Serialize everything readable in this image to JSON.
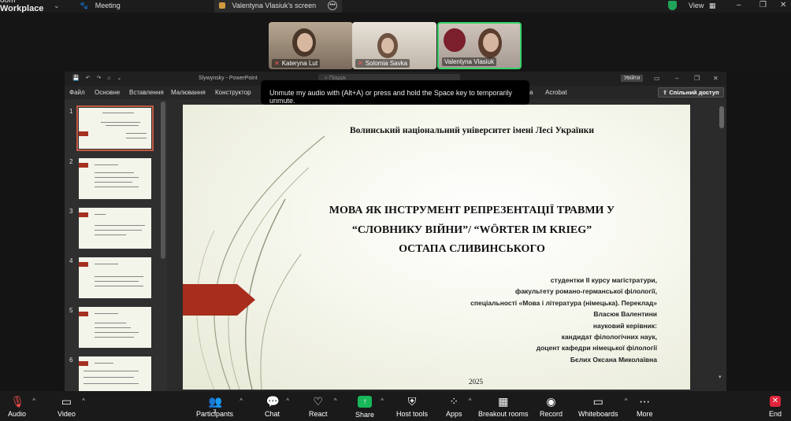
{
  "zoom": {
    "brand_line1": "oom",
    "brand_line2": "Workplace",
    "meeting_label": "Meeting",
    "screen_tab": "Valentyna Vlasiuk's screen",
    "view_label": "View"
  },
  "participants": [
    {
      "name": "Kateryna Lut"
    },
    {
      "name": "Solomia Savka"
    },
    {
      "name": "Valentyna Vlasiuk"
    }
  ],
  "tooltip": "Unmute my audio with (Alt+A) or press and hold the Space key to temporarily unmute.",
  "ppt": {
    "file_name": "Slywynsky - PowerPoint",
    "search_placeholder": "Пошук",
    "sign_in": "Увійти",
    "menu": [
      "Файл",
      "Основне",
      "Вставлення",
      "Малювання",
      "Конструктор",
      "Ч",
      "а",
      "Acrobat"
    ],
    "share_button": "Спільний доступ",
    "slide_numbers": [
      "1",
      "2",
      "3",
      "4",
      "5",
      "6"
    ]
  },
  "slide": {
    "university": "Волинський національний університет імені Лесі Українки",
    "title_line1": "МОВА ЯК ІНСТРУМЕНТ РЕПРЕЗЕНТАЦІЇ ТРАВМИ У",
    "title_line2": "“СЛОВНИКУ ВІЙНИ”/ “WÖRTER IM KRIEG”",
    "title_line3": "ОСТАПА СЛИВИНСЬКОГО",
    "author_lines": [
      "студентки ІІ курсу магістратури,",
      "факультету романо-германської філології,",
      "спеціальності «Мова і література (німецька). Переклад»",
      "Власюк Валентини",
      "науковий керівник:",
      "кандидат філологічних наук,",
      "доцент кафедри німецької філології",
      "Бєлих Оксана Миколаївна"
    ],
    "year": "2025"
  },
  "toolbar": {
    "audio": "Audio",
    "video": "Video",
    "participants": "Participants",
    "participants_count": "3",
    "chat": "Chat",
    "react": "React",
    "share": "Share",
    "host_tools": "Host tools",
    "apps": "Apps",
    "breakout_rooms": "Breakout rooms",
    "record": "Record",
    "whiteboards": "Whiteboards",
    "more": "More",
    "end": "End"
  },
  "colors": {
    "accent_red": "#a82d1d",
    "share_green": "#18b75a",
    "end_red": "#e0243a",
    "active_speaker": "#36d36a"
  }
}
